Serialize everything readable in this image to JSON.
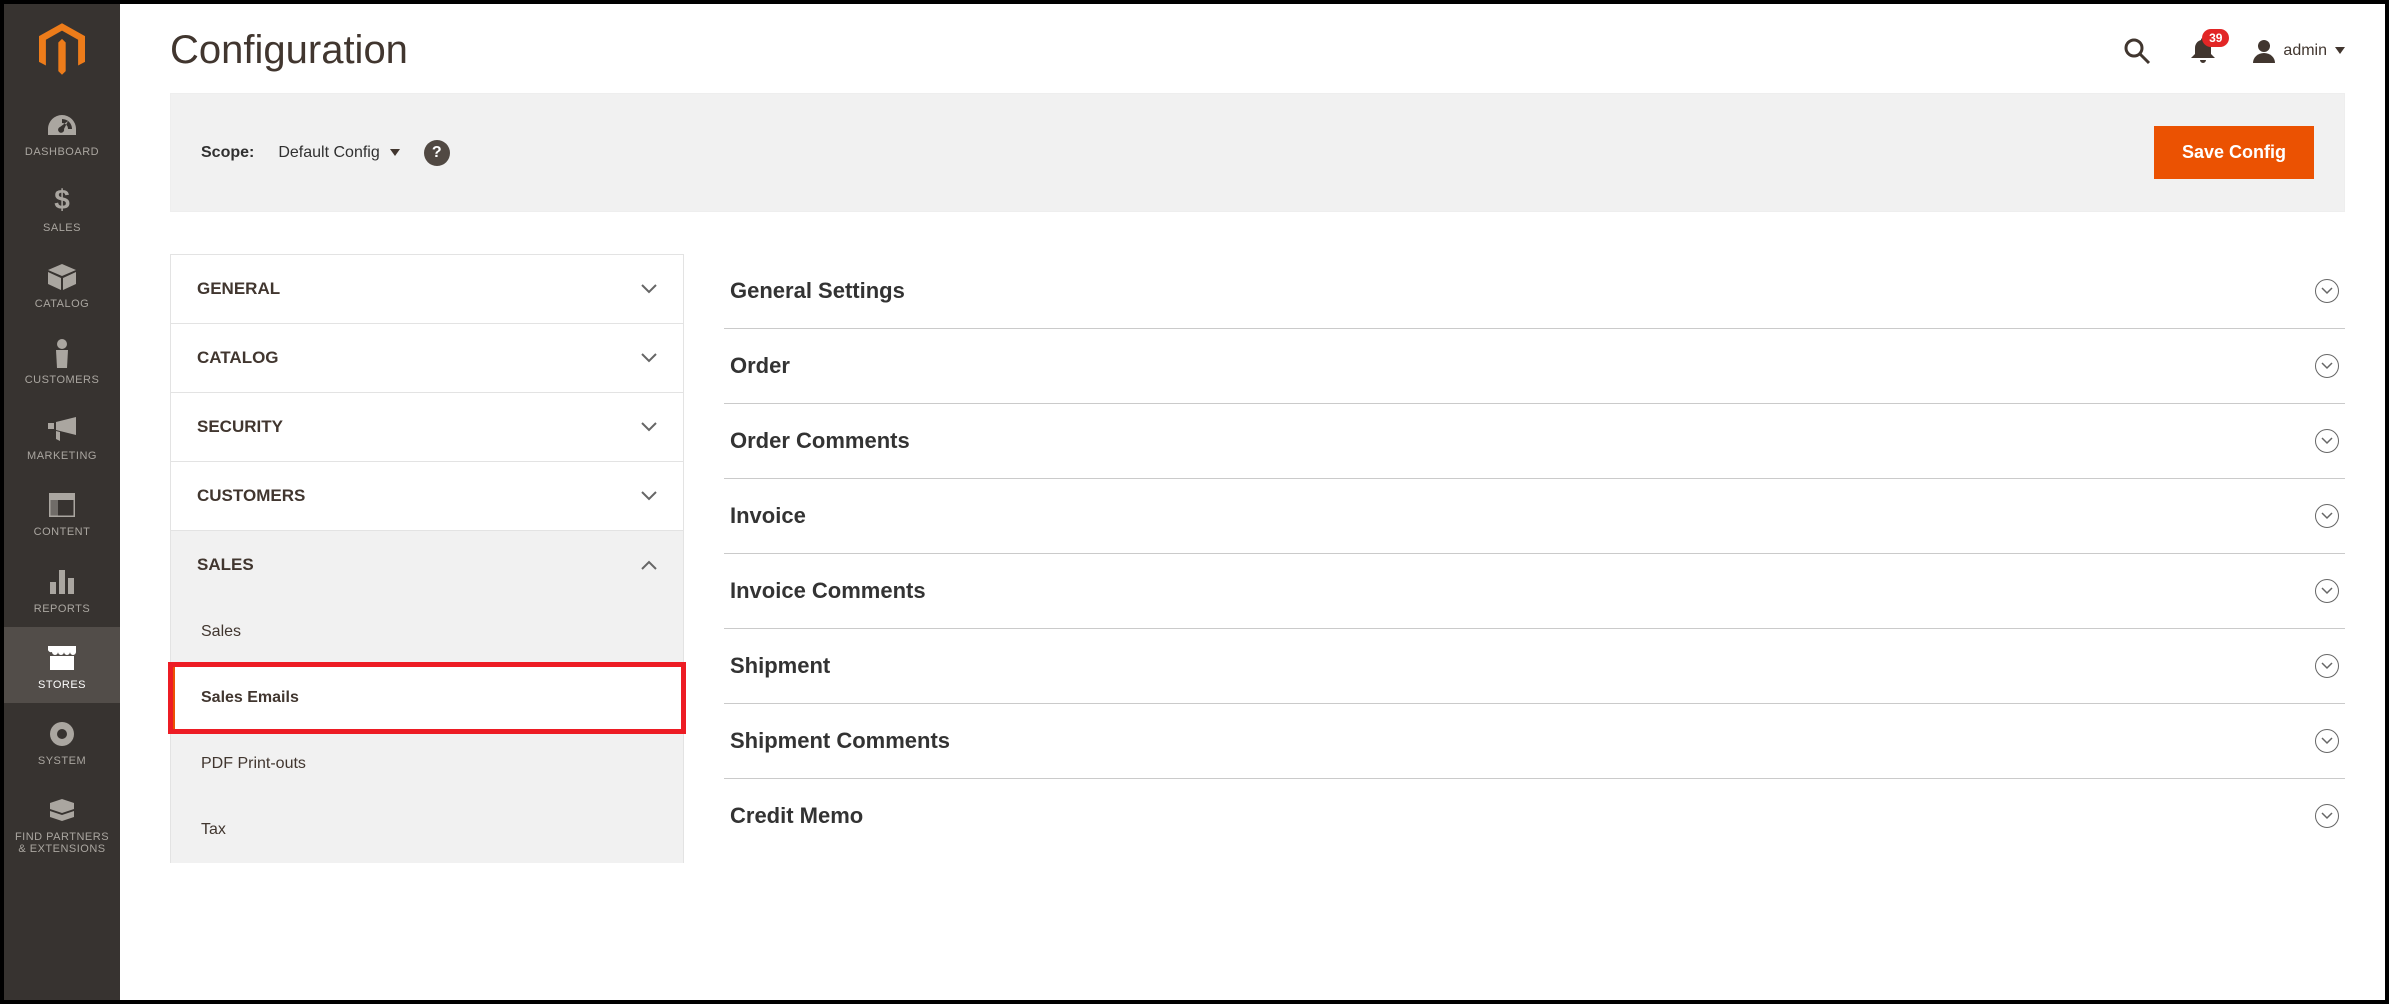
{
  "nav": {
    "items": [
      {
        "label": "DASHBOARD"
      },
      {
        "label": "SALES"
      },
      {
        "label": "CATALOG"
      },
      {
        "label": "CUSTOMERS"
      },
      {
        "label": "MARKETING"
      },
      {
        "label": "CONTENT"
      },
      {
        "label": "REPORTS"
      },
      {
        "label": "STORES"
      },
      {
        "label": "SYSTEM"
      },
      {
        "label": "FIND PARTNERS\n& EXTENSIONS"
      }
    ]
  },
  "page": {
    "title": "Configuration"
  },
  "header": {
    "notification_count": "39",
    "user_label": "admin"
  },
  "scope": {
    "label": "Scope:",
    "selected": "Default Config",
    "save_button": "Save Config",
    "help_text": "?"
  },
  "config_tabs": [
    {
      "label": "GENERAL"
    },
    {
      "label": "CATALOG"
    },
    {
      "label": "SECURITY"
    },
    {
      "label": "CUSTOMERS"
    },
    {
      "label": "SALES"
    }
  ],
  "config_sub_items": [
    {
      "label": "Sales"
    },
    {
      "label": "Sales Emails"
    },
    {
      "label": "PDF Print-outs"
    },
    {
      "label": "Tax"
    }
  ],
  "sections": [
    {
      "title": "General Settings"
    },
    {
      "title": "Order"
    },
    {
      "title": "Order Comments"
    },
    {
      "title": "Invoice"
    },
    {
      "title": "Invoice Comments"
    },
    {
      "title": "Shipment"
    },
    {
      "title": "Shipment Comments"
    },
    {
      "title": "Credit Memo"
    }
  ]
}
